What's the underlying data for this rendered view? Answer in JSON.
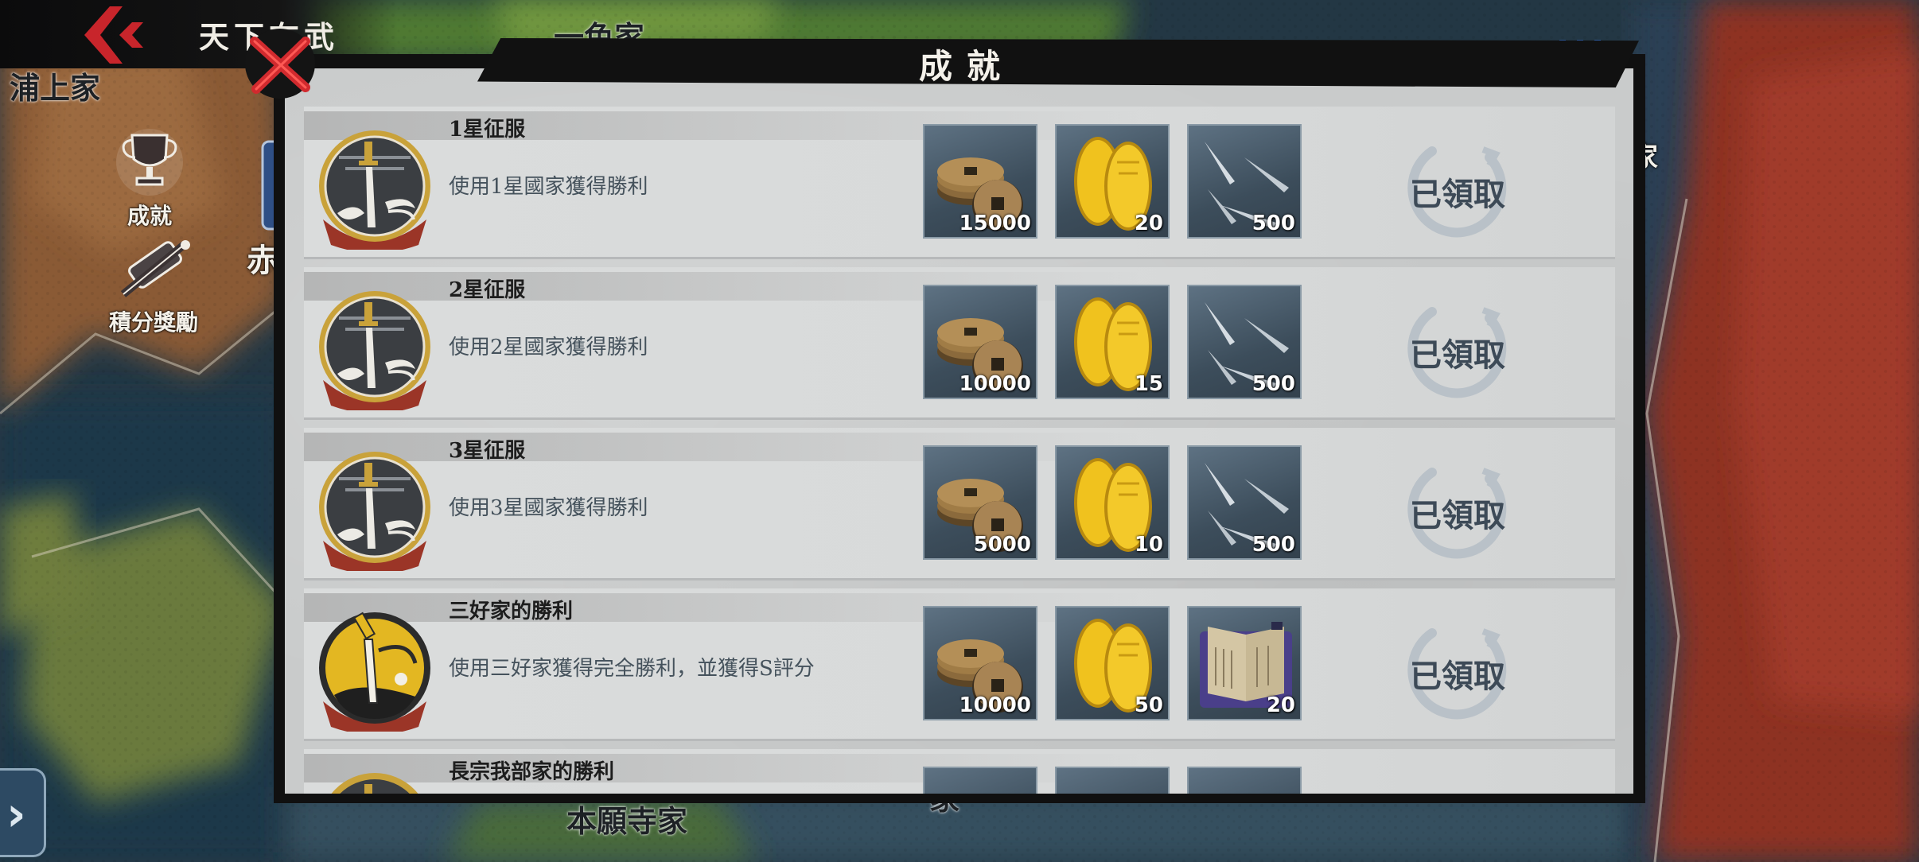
{
  "header": {
    "mode_title": "天下布武",
    "back_icon": "back-arrow-icon",
    "close_icon": "close-x-icon"
  },
  "sidebar": {
    "items": [
      {
        "label": "成就",
        "icon": "trophy-icon"
      },
      {
        "label": "積分獎勵",
        "icon": "scroll-brush-icon"
      }
    ],
    "expand_icon": "chevron-right-icon"
  },
  "map_labels": [
    "浦上家",
    "一色家",
    "赤",
    "家",
    "本願寺家",
    "家"
  ],
  "modal": {
    "title": "成就",
    "achievements": [
      {
        "name": "1星征服",
        "description": "使用1星國家獲得勝利",
        "badge": "gray",
        "rewards": [
          {
            "icon": "coin-icon",
            "qty": "15000"
          },
          {
            "icon": "gold-koban-icon",
            "qty": "20"
          },
          {
            "icon": "kunai-icon",
            "qty": "500"
          }
        ],
        "status": "已領取"
      },
      {
        "name": "2星征服",
        "description": "使用2星國家獲得勝利",
        "badge": "gray",
        "rewards": [
          {
            "icon": "coin-icon",
            "qty": "10000"
          },
          {
            "icon": "gold-koban-icon",
            "qty": "15"
          },
          {
            "icon": "kunai-icon",
            "qty": "500"
          }
        ],
        "status": "已領取"
      },
      {
        "name": "3星征服",
        "description": "使用3星國家獲得勝利",
        "badge": "gray",
        "rewards": [
          {
            "icon": "coin-icon",
            "qty": "5000"
          },
          {
            "icon": "gold-koban-icon",
            "qty": "10"
          },
          {
            "icon": "kunai-icon",
            "qty": "500"
          }
        ],
        "status": "已領取"
      },
      {
        "name": "三好家的勝利",
        "description": "使用三好家獲得完全勝利，並獲得S評分",
        "badge": "gold",
        "rewards": [
          {
            "icon": "coin-icon",
            "qty": "10000"
          },
          {
            "icon": "gold-koban-icon",
            "qty": "50"
          },
          {
            "icon": "book-icon",
            "qty": "20"
          }
        ],
        "status": "已領取"
      },
      {
        "name": "長宗我部家的勝利",
        "description": "",
        "badge": "gray",
        "rewards": [],
        "status": ""
      }
    ]
  },
  "colors": {
    "accent_red": "#c8252b",
    "claimed_text": "#3d4a57",
    "panel_bg": "#c9cbcb"
  }
}
